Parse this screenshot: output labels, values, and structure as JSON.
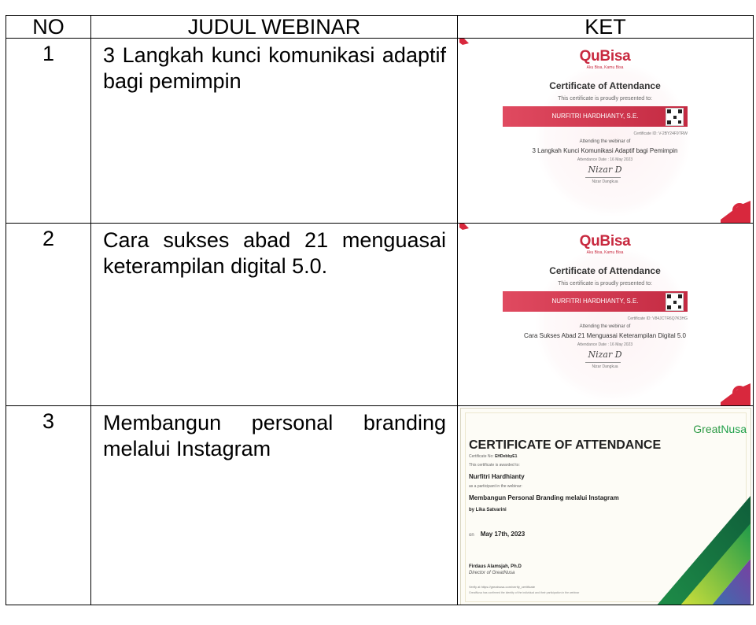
{
  "headers": {
    "no": "NO",
    "title": "JUDUL WEBINAR",
    "ket": "KET"
  },
  "rows": [
    {
      "no": "1",
      "title": "3 Langkah kunci komunikasi adaptif bagi pemimpin",
      "cert": {
        "logo": "QuBisa",
        "tagline": "Aku Bisa, Kamu Bisa",
        "heading": "Certificate of Attendance",
        "presented": "This certificate is proudly presented to:",
        "name": "NURFITRI HARDHIANTY, S.E.",
        "id": "Certificate ID: V-2BY24F9TRW",
        "attending": "Attending the webinar of",
        "webinar": "3 Langkah Kunci Komunikasi Adaptif bagi Pemimpin",
        "date": "Attendance Date : 16 May 2023",
        "signature": "Nizar D",
        "signer": "Nizar Dangkua",
        "accent": "#c8293f"
      }
    },
    {
      "no": "2",
      "title": "Cara sukses abad 21 menguasai keterampilan digital 5.0.",
      "cert": {
        "logo": "QuBisa",
        "tagline": "Aku Bisa, Kamu Bisa",
        "heading": "Certificate of Attendance",
        "presented": "This certificate is proudly presented to:",
        "name": "NURFITRI HARDHIANTY, S.E.",
        "id": "Certificate ID: V84JCTR6Q7K3HG",
        "attending": "Attending the webinar of",
        "webinar": "Cara Sukses Abad 21 Menguasai Keterampilan Digital 5.0",
        "date": "Attendance Date : 16 May 2023",
        "signature": "Nizar D",
        "signer": "Nizar Dangkua",
        "accent": "#c8293f"
      }
    },
    {
      "no": "3",
      "title": "Membangun personal branding melalui Instagram",
      "cert": {
        "logo_a": "Great",
        "logo_b": "Nusa",
        "heading": "CERTIFICATE OF ATTENDANCE",
        "cert_no_label": "Certificate No:",
        "cert_no": "EHDebbyE1",
        "awarded": "This certificate is awarded to:",
        "name": "Nurfitri Hardhianty",
        "participant": "as a participant in the webinar:",
        "webinar": "Membangun Personal Branding melalui Instagram",
        "by": "by Lika Satvarini",
        "on_label": "on",
        "date": "May 17th, 2023",
        "signer": "Firdaus Alamsjah, Ph.D",
        "signer_role": "Director of GreatNusa",
        "verify": "Verify at https://greatnusa.com/verify_certificate",
        "confirm": "GreatNusa has confirmed the identity of the individual and their participation in the webinar",
        "accent": "#1fa04a"
      }
    }
  ]
}
